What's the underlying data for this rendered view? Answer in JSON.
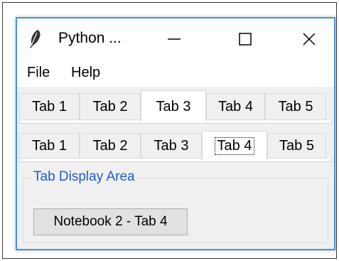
{
  "window": {
    "title": "Python ...",
    "icon": "feather-icon",
    "controls": [
      "minimize-icon",
      "maximize-icon",
      "close-icon"
    ]
  },
  "menu": {
    "items": [
      "File",
      "Help"
    ]
  },
  "notebook1": {
    "tabs": [
      "Tab 1",
      "Tab 2",
      "Tab 3",
      "Tab 4",
      "Tab 5"
    ],
    "selected": "Tab 3"
  },
  "notebook2": {
    "tabs": [
      "Tab 1",
      "Tab 2",
      "Tab 3",
      "Tab 4",
      "Tab 5"
    ],
    "selected": "Tab 4"
  },
  "display_area": {
    "label": "Tab Display Area",
    "button": "Notebook 2 - Tab 4"
  },
  "colors": {
    "window_border": "#4a90d9",
    "frame_label": "#1f5bd1",
    "background": "#f0f0f0"
  }
}
